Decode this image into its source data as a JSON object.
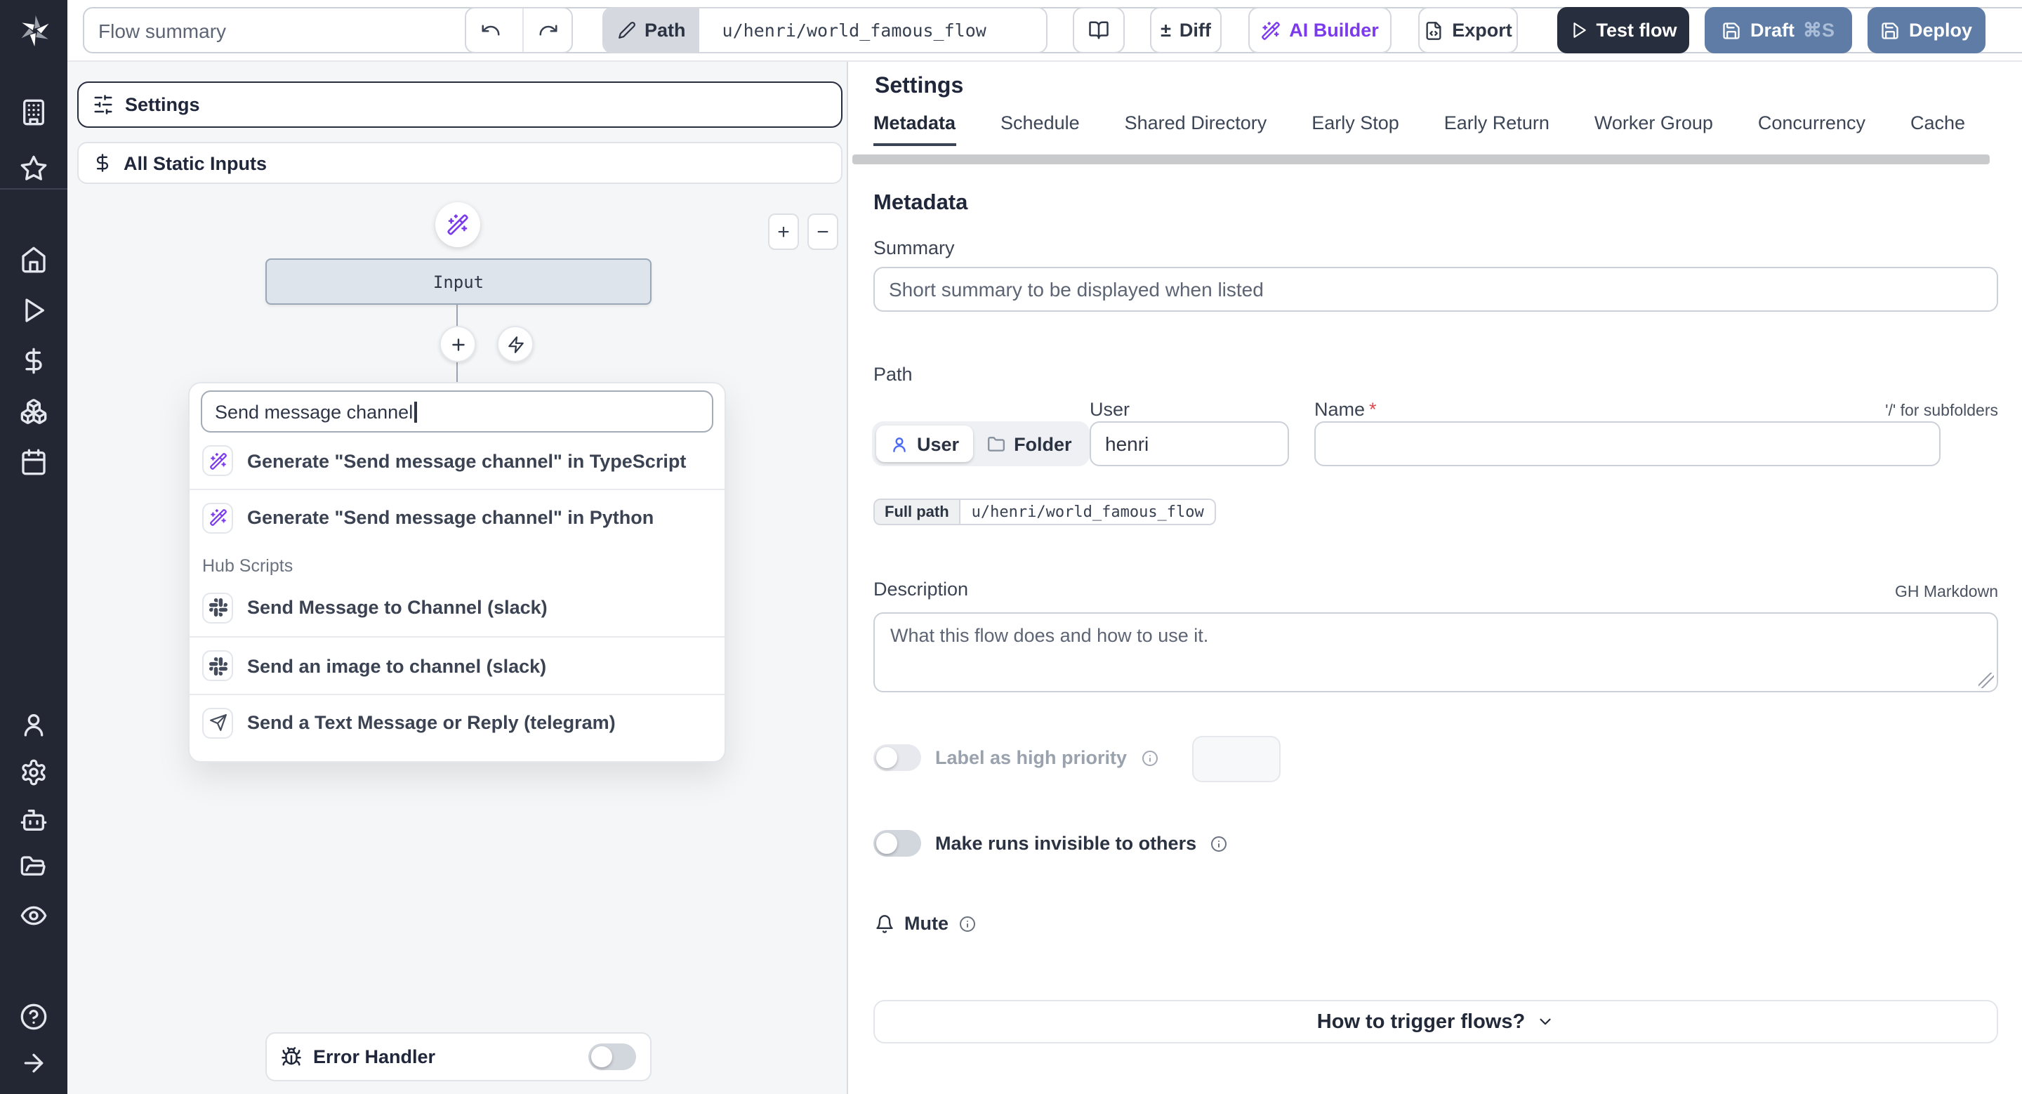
{
  "toolbar": {
    "flow_summary_placeholder": "Flow summary",
    "path_chip_label": "Path",
    "path_chip_value": "u/henri/world_famous_flow",
    "diff_symbol": "±",
    "diff_label": "Diff",
    "ai_builder_label": "AI Builder",
    "export_label": "Export",
    "test_flow_label": "Test flow",
    "draft_label": "Draft",
    "draft_shortcut": "⌘S",
    "deploy_label": "Deploy"
  },
  "sidebar": {
    "icons": [
      "building",
      "star",
      "home",
      "play",
      "dollar",
      "boxes",
      "calendar",
      "user",
      "gear",
      "bot",
      "folder-open",
      "eye",
      "help-circle",
      "arrow-right"
    ]
  },
  "flow_editor": {
    "settings_row_label": "Settings",
    "static_inputs_row_label": "All Static Inputs",
    "input_node_label": "Input",
    "zoom_in_label": "+",
    "zoom_out_label": "−",
    "search_value": "Send message channel",
    "ai_suggestions": [
      {
        "icon": "wand-sparkles",
        "label": "Generate \"Send message channel\" in TypeScript"
      },
      {
        "icon": "wand-sparkles",
        "label": "Generate \"Send message channel\" in Python"
      }
    ],
    "hub_section_label": "Hub Scripts",
    "hub_scripts": [
      {
        "icon": "slack",
        "label": "Send Message to Channel (slack)"
      },
      {
        "icon": "slack",
        "label": "Send an image to channel (slack)"
      },
      {
        "icon": "send",
        "label": "Send a Text Message or Reply (telegram)"
      }
    ],
    "error_handler_label": "Error Handler"
  },
  "settings_panel": {
    "title": "Settings",
    "active_tab": "Metadata",
    "tabs": [
      "Metadata",
      "Schedule",
      "Shared Directory",
      "Early Stop",
      "Early Return",
      "Worker Group",
      "Concurrency",
      "Cache"
    ],
    "metadata": {
      "heading": "Metadata",
      "summary_label": "Summary",
      "summary_placeholder": "Short summary to be displayed when listed",
      "path_label": "Path",
      "owner_user_label": "User",
      "owner_folder_label": "Folder",
      "user_label": "User",
      "user_value": "henri",
      "name_label": "Name",
      "required_marker": "*",
      "subfolder_hint": "'/' for subfolders",
      "full_path_label": "Full path",
      "full_path_value": "u/henri/world_famous_flow",
      "description_label": "Description",
      "markdown_hint": "GH Markdown",
      "description_placeholder": "What this flow does and how to use it.",
      "high_priority_label": "Label as high priority",
      "invisible_runs_label": "Make runs invisible to others",
      "mute_label": "Mute",
      "trigger_help_label": "How to trigger flows?"
    }
  },
  "colors": {
    "accent_purple": "#7c3aed",
    "primary_dark": "#272e3d",
    "deploy_blue": "#5f7ca7",
    "rail_dark": "#232733",
    "node_fill": "#dde4ec",
    "required_red": "#e5484d"
  }
}
